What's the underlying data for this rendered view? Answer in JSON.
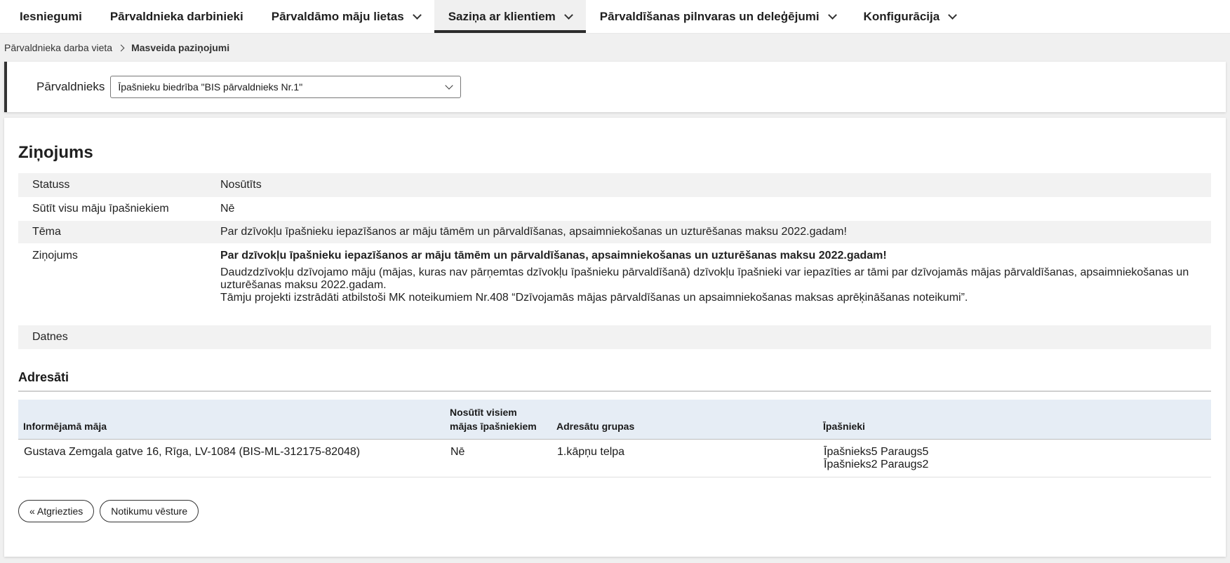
{
  "nav": {
    "items": [
      {
        "label": "Iesniegumi",
        "has_dropdown": false,
        "active": false
      },
      {
        "label": "Pārvaldnieka darbinieki",
        "has_dropdown": false,
        "active": false
      },
      {
        "label": "Pārvaldāmo māju lietas",
        "has_dropdown": true,
        "active": false
      },
      {
        "label": "Saziņa ar klientiem",
        "has_dropdown": true,
        "active": true
      },
      {
        "label": "Pārvaldīšanas pilnvaras un deleģējumi",
        "has_dropdown": true,
        "active": false
      },
      {
        "label": "Konfigurācija",
        "has_dropdown": true,
        "active": false
      }
    ]
  },
  "breadcrumb": {
    "parent": "Pārvaldnieka darba vieta",
    "current": "Masveida paziņojumi"
  },
  "manager": {
    "label": "Pārvaldnieks",
    "selected": "Īpašnieku biedrība \"BIS pārvaldnieks Nr.1\""
  },
  "message": {
    "title": "Ziņojums",
    "status_label": "Statuss",
    "status_value": "Nosūtīts",
    "send_all_label": "Sūtīt visu māju īpašniekiem",
    "send_all_value": "Nē",
    "theme_label": "Tēma",
    "theme_value": "Par dzīvokļu īpašnieku iepazīšanos ar māju tāmēm un pārvaldīšanas, apsaimniekošanas un uzturēšanas maksu 2022.gadam!",
    "body_label": "Ziņojums",
    "body_heading": "Par dzīvokļu īpašnieku iepazīšanos ar māju tāmēm un pārvaldīšanas, apsaimniekošanas un uzturēšanas maksu 2022.gadam!",
    "body_paragraph_1": "Daudzdzīvokļu dzīvojamo māju (mājas, kuras nav pārņemtas dzīvokļu īpašnieku pārvaldīšanā) dzīvokļu īpašnieki var iepazīties ar tāmi par dzīvojamās mājas pārvaldīšanas, apsaimniekošanas un uzturēšanas maksu 2022.gadam.",
    "body_paragraph_2": "Tāmju projekti izstrādāti atbilstoši MK noteikumiem Nr.408 “Dzīvojamās mājas pārvaldīšanas un apsaimniekošanas maksas aprēķināšanas noteikumi”.",
    "files_label": "Datnes"
  },
  "recipients": {
    "title": "Adresāti",
    "columns": {
      "house": "Informējamā māja",
      "send_all": "Nosūtīt visiem mājas īpašniekiem",
      "groups": "Adresātu grupas",
      "owners": "Īpašnieki"
    },
    "rows": [
      {
        "house": "Gustava Zemgala gatve 16, Rīga, LV-1084 (BIS-ML-312175-82048)",
        "send_all": "Nē",
        "groups": "1.kāpņu telpa",
        "owner_1": "Īpašnieks5 Paraugs5",
        "owner_2": "Īpašnieks2 Paraugs2"
      }
    ]
  },
  "buttons": {
    "back": "« Atgriezties",
    "history": "Notikumu vēsture"
  }
}
